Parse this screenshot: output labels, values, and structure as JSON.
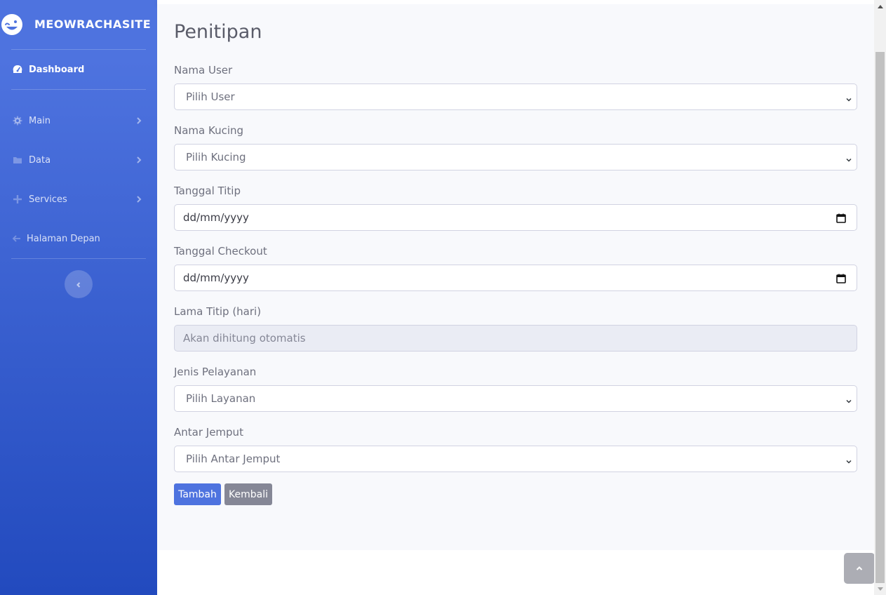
{
  "sidebar": {
    "brand": "MEOWRACHASITE",
    "items": [
      {
        "label": "Dashboard",
        "icon": "tachometer-icon",
        "active": true
      },
      {
        "label": "Main",
        "icon": "gear-icon",
        "has_submenu": true
      },
      {
        "label": "Data",
        "icon": "folder-icon",
        "has_submenu": true
      },
      {
        "label": "Services",
        "icon": "plus-icon",
        "has_submenu": true
      },
      {
        "label": "Halaman Depan",
        "icon": "arrow-left-icon"
      }
    ]
  },
  "page": {
    "title": "Penitipan"
  },
  "form": {
    "user_label": "Nama User",
    "user_value": "Pilih User",
    "cat_label": "Nama Kucing",
    "cat_value": "Pilih Kucing",
    "checkin_label": "Tanggal Titip",
    "checkin_placeholder": "dd/mm/yyyy",
    "checkout_label": "Tanggal Checkout",
    "checkout_placeholder": "dd/mm/yyyy",
    "duration_label": "Lama Titip (hari)",
    "duration_placeholder": "Akan dihitung otomatis",
    "service_label": "Jenis Pelayanan",
    "service_value": "Pilih Layanan",
    "pickup_label": "Antar Jemput",
    "pickup_value": "Pilih Antar Jemput",
    "submit_label": "Tambah",
    "back_label": "Kembali"
  },
  "colors": {
    "primary": "#4e73df",
    "secondary": "#858796",
    "sidebar_gradient_end": "#224abe"
  }
}
